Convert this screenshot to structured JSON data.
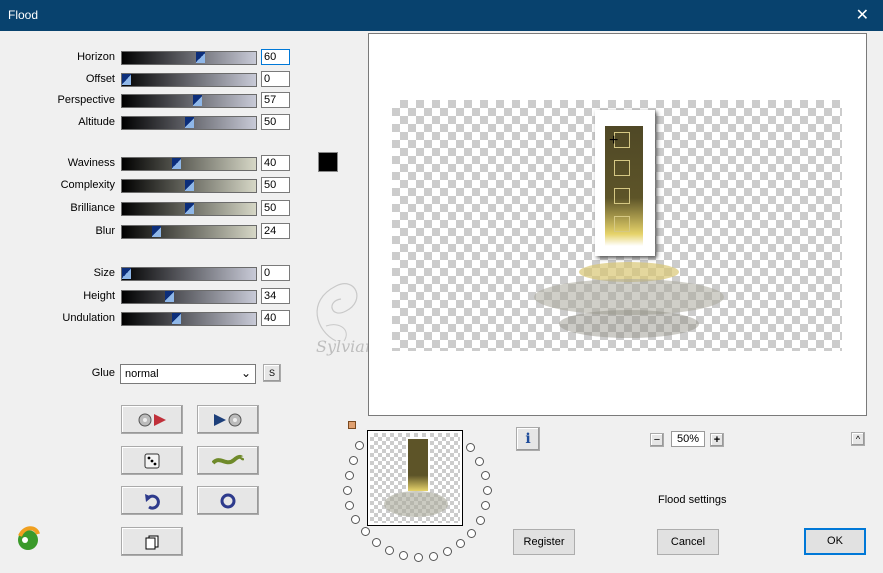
{
  "window": {
    "title": "Flood",
    "close_glyph": "✕"
  },
  "sliders": [
    {
      "label": "Horizon",
      "value": "60",
      "frac": 0.59
    },
    {
      "label": "Offset",
      "value": "0",
      "frac": 0.0
    },
    {
      "label": "Perspective",
      "value": "57",
      "frac": 0.57
    },
    {
      "label": "Altitude",
      "value": "50",
      "frac": 0.5
    },
    {
      "label": "Waviness",
      "value": "40",
      "frac": 0.4
    },
    {
      "label": "Complexity",
      "value": "50",
      "frac": 0.5
    },
    {
      "label": "Brilliance",
      "value": "50",
      "frac": 0.5
    },
    {
      "label": "Blur",
      "value": "24",
      "frac": 0.24
    },
    {
      "label": "Size",
      "value": "0",
      "frac": 0.0
    },
    {
      "label": "Height",
      "value": "34",
      "frac": 0.34
    },
    {
      "label": "Undulation",
      "value": "40",
      "frac": 0.4
    }
  ],
  "glue": {
    "label": "Glue",
    "value": "normal",
    "s_label": "S"
  },
  "color_swatch": "#000000",
  "zoom": {
    "minus": "−",
    "value": "50%",
    "plus": "+"
  },
  "info_glyph": "i",
  "collapse_glyph": "^",
  "status": "Flood settings",
  "buttons": {
    "register": "Register",
    "cancel": "Cancel",
    "ok": "OK"
  },
  "watermark": "Sylviane",
  "colors": {
    "titlebar": "#08426e",
    "thumb": "#0c2e7a",
    "default_border": "#0078d7"
  }
}
